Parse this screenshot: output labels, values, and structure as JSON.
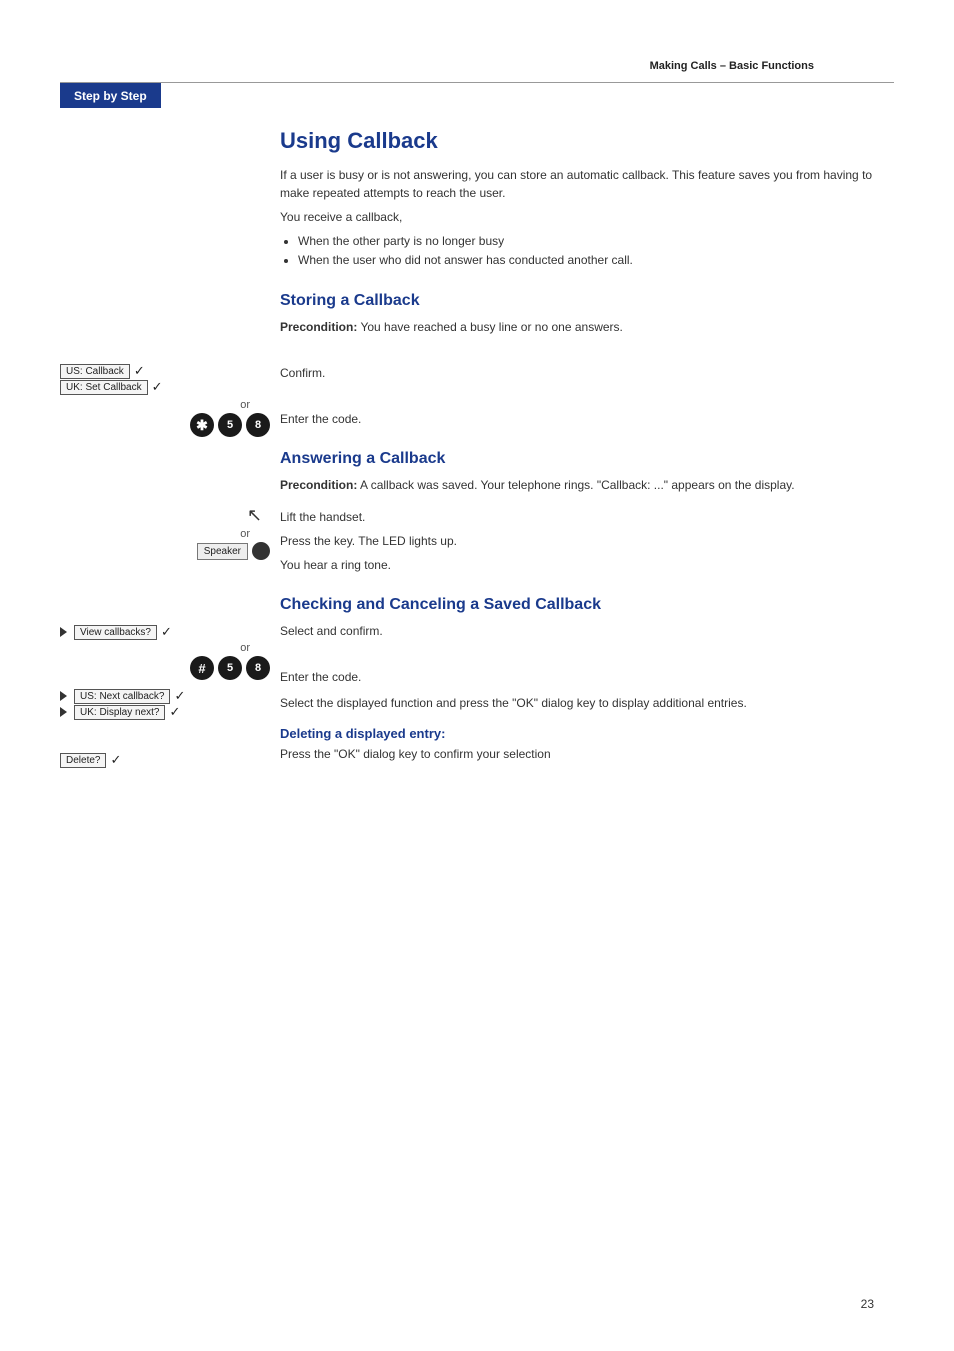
{
  "header": {
    "title": "Making Calls – Basic Functions"
  },
  "stepByStep": {
    "label": "Step by Step"
  },
  "mainTitle": "Using Callback",
  "intro": {
    "para1": "If a user is busy or is not answering, you can store an automatic callback. This feature saves you from having to make repeated attempts to reach the user.",
    "para2": "You receive a callback,",
    "bullets": [
      "When the other party is no longer busy",
      "When the user who did not answer has conducted another call."
    ]
  },
  "sections": {
    "storing": {
      "title": "Storing a Callback",
      "precondition": "Precondition:",
      "preconditionText": " You have reached a busy line or no one answers.",
      "actions": [
        {
          "left_keys": [
            "US: Callback",
            "UK: Set Callback"
          ],
          "description": "Confirm."
        },
        {
          "or": true,
          "code_buttons": [
            "*",
            "5",
            "8"
          ],
          "description": "Enter the code."
        }
      ]
    },
    "answering": {
      "title": "Answering a Callback",
      "precondition": "Precondition:",
      "preconditionText": " A callback was saved. Your telephone rings. \"Callback: ...\" appears on the display.",
      "actions": [
        {
          "lift_handset": true,
          "or": true,
          "speaker": "Speaker",
          "description1": "Lift the handset.",
          "description2": "Press the key. The LED lights up.",
          "description3": "You hear a ring tone."
        }
      ]
    },
    "checking": {
      "title": "Checking and Canceling a Saved Callback",
      "actions": [
        {
          "key": "View callbacks?",
          "hasArrow": true,
          "or": true,
          "code_buttons": [
            "#",
            "5",
            "8"
          ],
          "description": "Select and confirm.",
          "description2": "Enter the code."
        },
        {
          "keys": [
            "US: Next callback?",
            "UK: Display next?"
          ],
          "hasArrow": true,
          "description": "Select the displayed function and press the \"OK\" dialog key to display additional entries."
        },
        {
          "subsection": "Deleting a displayed entry:",
          "key": "Delete?",
          "description": "Press the \"OK\" dialog key to confirm your selection"
        }
      ]
    }
  },
  "pageNumber": "23"
}
